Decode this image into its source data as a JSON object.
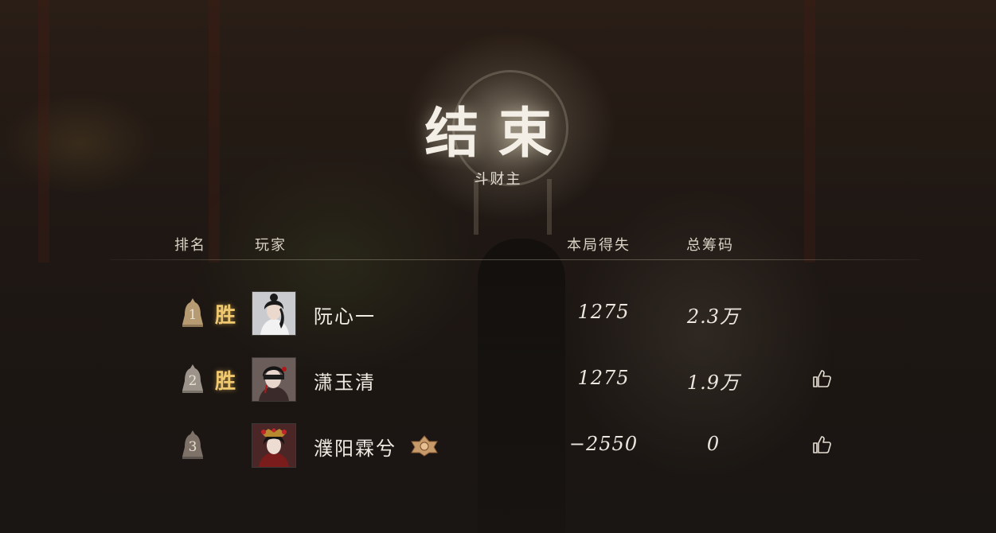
{
  "header": {
    "title": "结束",
    "subtitle": "斗财主"
  },
  "table": {
    "columns": {
      "rank": "排名",
      "player": "玩家",
      "round_gain": "本局得失",
      "total_chips": "总筹码"
    },
    "rows": [
      {
        "rank": "1",
        "badge": "胜",
        "name": "阮心一",
        "round_gain": "1275",
        "total_chips": "2.3万",
        "avatar_icon": "female-character-portrait-white-robe",
        "has_like_button": false,
        "has_crest": false
      },
      {
        "rank": "2",
        "badge": "胜",
        "name": "潇玉清",
        "round_gain": "1275",
        "total_chips": "1.9万",
        "avatar_icon": "female-character-portrait-blindfold",
        "has_like_button": true,
        "has_crest": false
      },
      {
        "rank": "3",
        "badge": "",
        "name": "濮阳霖兮",
        "round_gain": "−2550",
        "total_chips": "0",
        "avatar_icon": "female-character-portrait-red-headdress",
        "has_like_button": true,
        "has_crest": true
      }
    ]
  },
  "colors": {
    "win_badge": "#f0c870",
    "text": "#e9e4da",
    "background": "#1e1713"
  },
  "icons": {
    "rank": "bell-icon",
    "like": "thumbs-up-icon",
    "crest": "ornate-crest-icon"
  }
}
